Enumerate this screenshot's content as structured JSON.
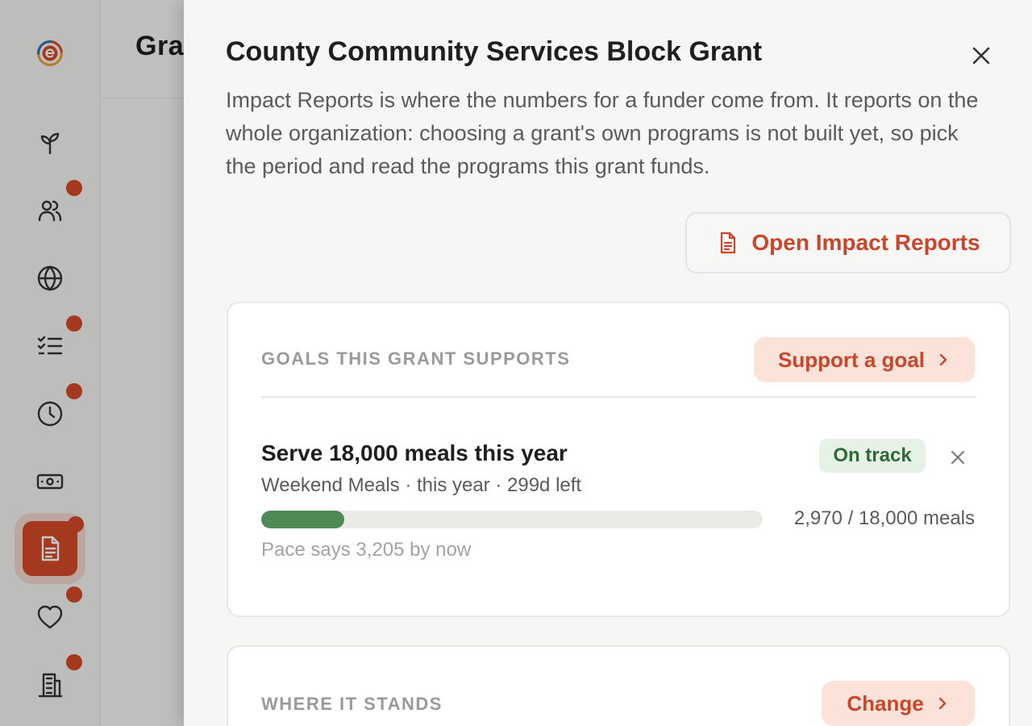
{
  "rail": {
    "items": [
      {
        "name": "plant-icon",
        "dot": false
      },
      {
        "name": "people-icon",
        "dot": true
      },
      {
        "name": "globe-icon",
        "dot": false
      },
      {
        "name": "checklist-icon",
        "dot": true
      },
      {
        "name": "clock-icon",
        "dot": true
      },
      {
        "name": "money-icon",
        "dot": false
      },
      {
        "name": "document-icon",
        "dot": true,
        "active": true
      },
      {
        "name": "heart-icon",
        "dot": true
      },
      {
        "name": "building-icon",
        "dot": true
      }
    ]
  },
  "page": {
    "title": "Gra"
  },
  "drawer": {
    "title": "County Community Services Block Grant",
    "description": "Impact Reports is where the numbers for a funder come from. It reports on the whole organization: choosing a grant's own programs is not built yet, so pick the period and read the programs this grant funds.",
    "open_reports_label": "Open Impact Reports",
    "goals_card": {
      "label": "GOALS THIS GRANT SUPPORTS",
      "action_label": "Support a goal",
      "goal": {
        "title": "Serve 18,000 meals this year",
        "meta": "Weekend Meals · this year · 299d left",
        "status": "On track",
        "progress_fraction": 0.165,
        "progress_text": "2,970 / 18,000 meals",
        "pace_note": "Pace says 3,205 by now"
      }
    },
    "standing_card": {
      "label": "WHERE IT STANDS",
      "action_label": "Change"
    }
  },
  "colors": {
    "accent": "#d2492a",
    "success": "#4f8a56"
  }
}
